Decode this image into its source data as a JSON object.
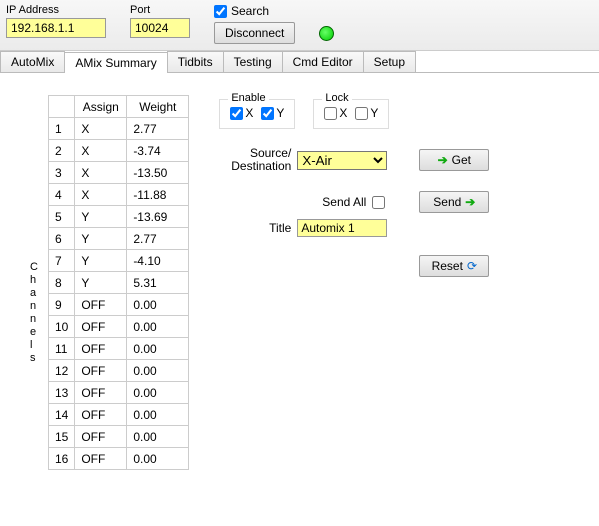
{
  "top": {
    "ip_label": "IP Address",
    "ip_value": "192.168.1.1",
    "port_label": "Port",
    "port_value": "10024",
    "search_label": "Search",
    "search_checked": true,
    "disconnect_label": "Disconnect"
  },
  "tabs": [
    {
      "label": "AutoMix"
    },
    {
      "label": "AMix Summary"
    },
    {
      "label": "Tidbits"
    },
    {
      "label": "Testing"
    },
    {
      "label": "Cmd Editor"
    },
    {
      "label": "Setup"
    }
  ],
  "active_tab_index": 1,
  "channels_label": "Channels",
  "grid": {
    "headers": {
      "rownum": "",
      "assign": "Assign",
      "weight": "Weight"
    },
    "rows": [
      {
        "n": "1",
        "assign": "X",
        "weight": "2.77"
      },
      {
        "n": "2",
        "assign": "X",
        "weight": "-3.74"
      },
      {
        "n": "3",
        "assign": "X",
        "weight": "-13.50"
      },
      {
        "n": "4",
        "assign": "X",
        "weight": "-11.88"
      },
      {
        "n": "5",
        "assign": "Y",
        "weight": "-13.69"
      },
      {
        "n": "6",
        "assign": "Y",
        "weight": "2.77"
      },
      {
        "n": "7",
        "assign": "Y",
        "weight": "-4.10"
      },
      {
        "n": "8",
        "assign": "Y",
        "weight": "5.31"
      },
      {
        "n": "9",
        "assign": "OFF",
        "weight": "0.00"
      },
      {
        "n": "10",
        "assign": "OFF",
        "weight": "0.00"
      },
      {
        "n": "11",
        "assign": "OFF",
        "weight": "0.00"
      },
      {
        "n": "12",
        "assign": "OFF",
        "weight": "0.00"
      },
      {
        "n": "13",
        "assign": "OFF",
        "weight": "0.00"
      },
      {
        "n": "14",
        "assign": "OFF",
        "weight": "0.00"
      },
      {
        "n": "15",
        "assign": "OFF",
        "weight": "0.00"
      },
      {
        "n": "16",
        "assign": "OFF",
        "weight": "0.00"
      }
    ]
  },
  "enable": {
    "title": "Enable",
    "x_label": "X",
    "x_checked": true,
    "y_label": "Y",
    "y_checked": true
  },
  "lock": {
    "title": "Lock",
    "x_label": "X",
    "x_checked": false,
    "y_label": "Y",
    "y_checked": false
  },
  "source": {
    "label_line1": "Source/",
    "label_line2": "Destination",
    "options": [
      "X-Air"
    ],
    "selected": "X-Air"
  },
  "buttons": {
    "get": "Get",
    "send": "Send",
    "reset": "Reset"
  },
  "send_all": {
    "label": "Send All",
    "checked": false
  },
  "title_field": {
    "label": "Title",
    "value": "Automix 1"
  }
}
